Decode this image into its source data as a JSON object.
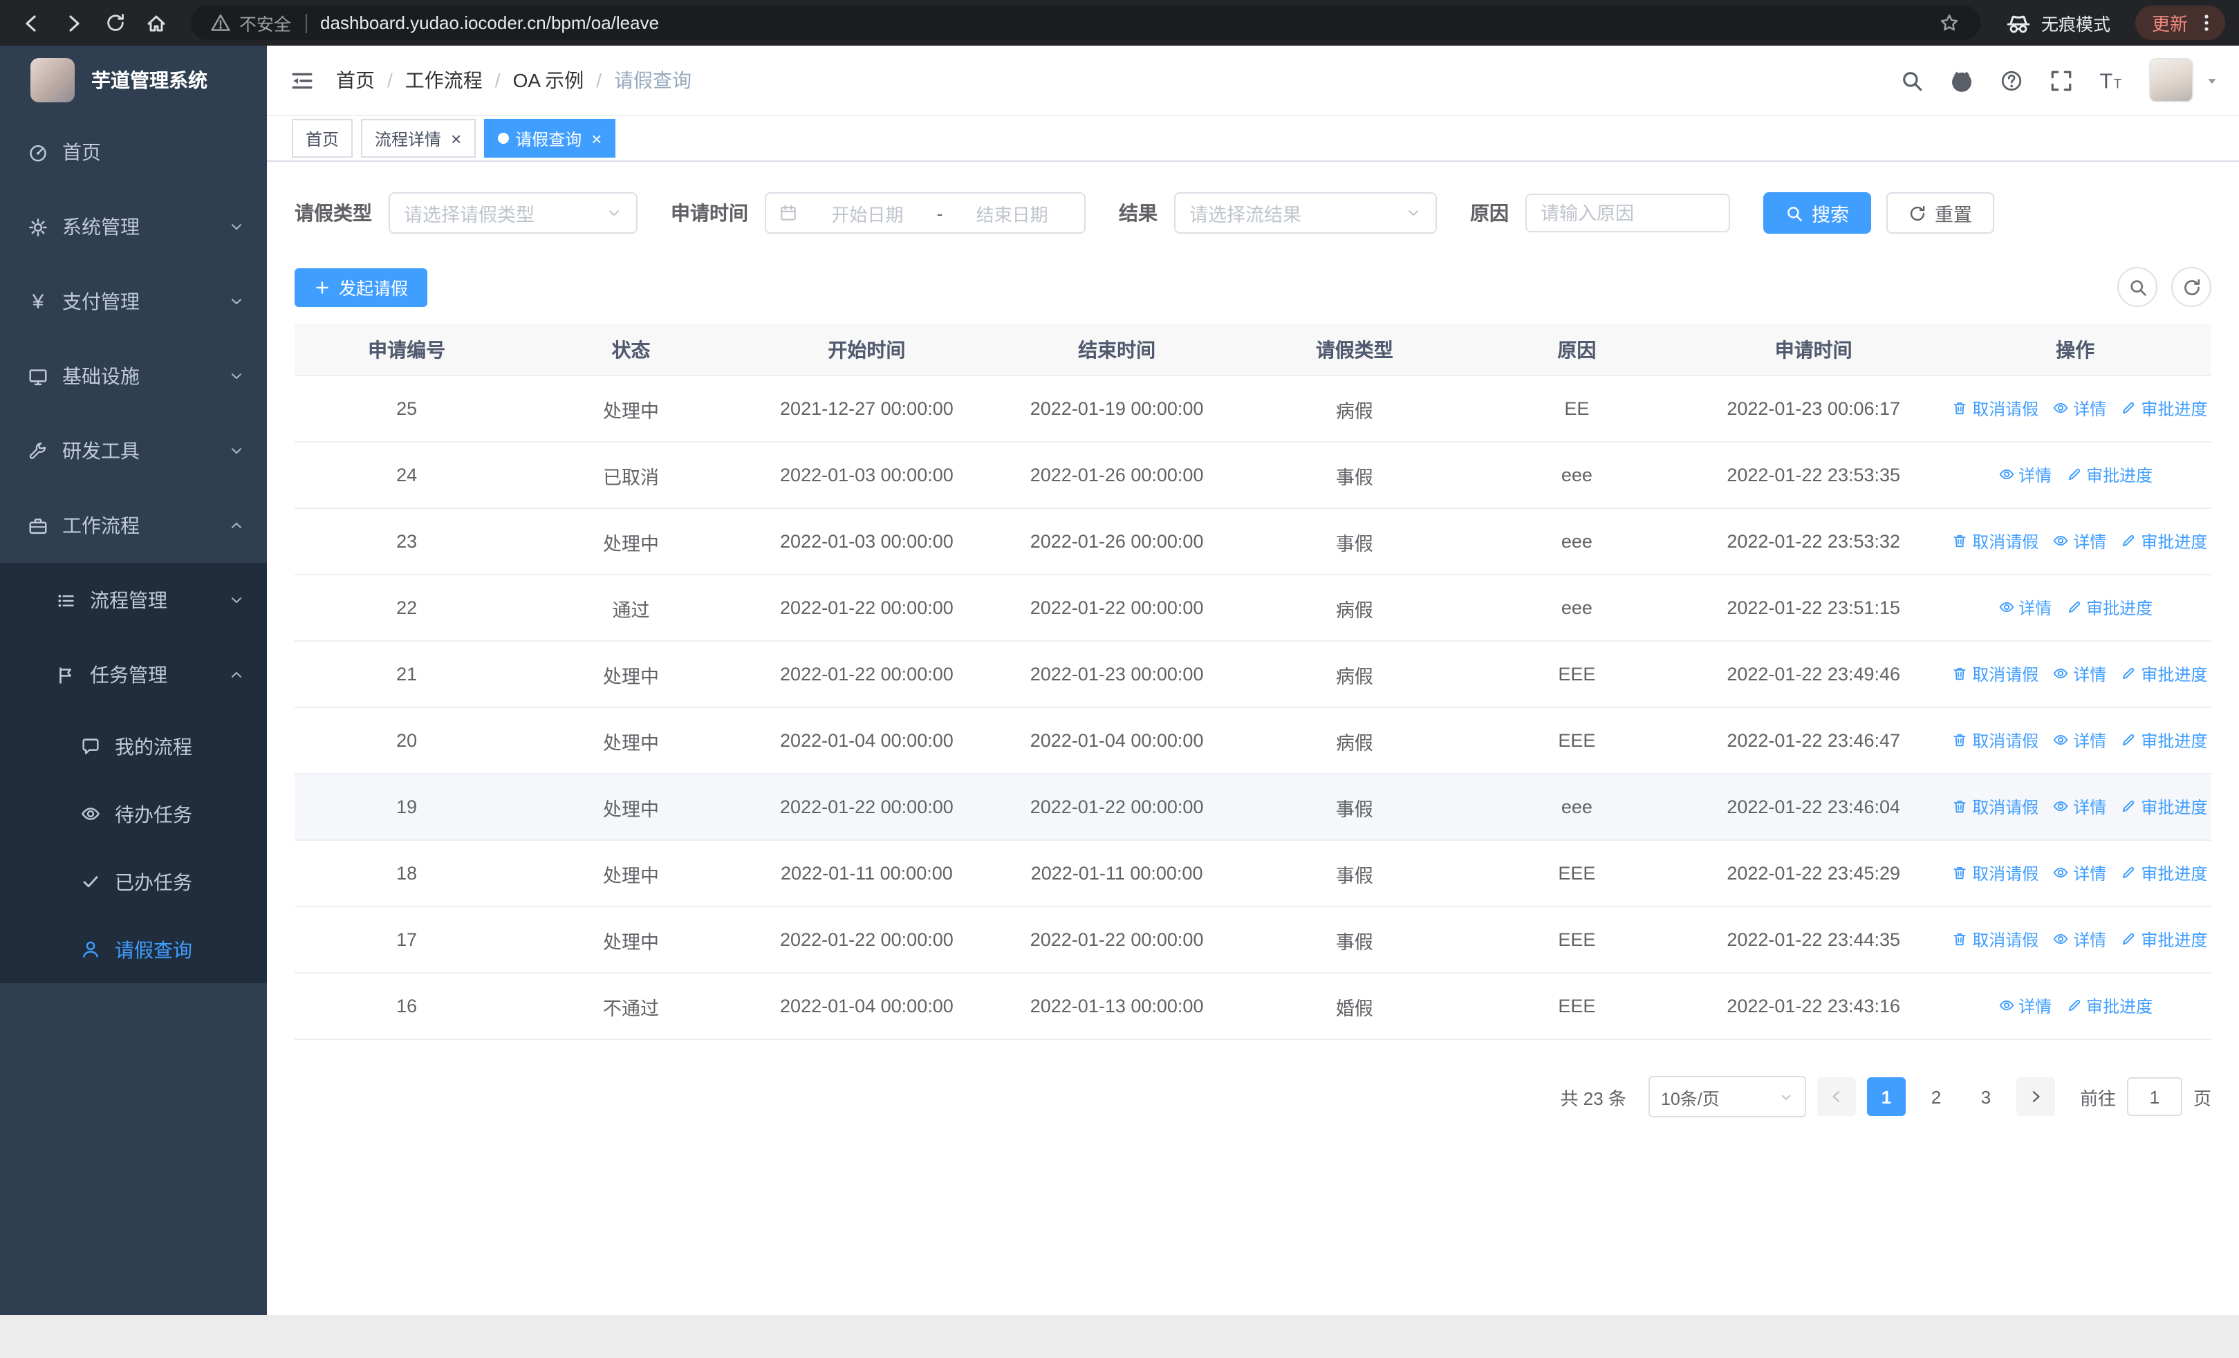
{
  "browser": {
    "url": "dashboard.yudao.iocoder.cn/bpm/oa/leave",
    "security_label": "不安全",
    "incognito_label": "无痕模式",
    "update_label": "更新"
  },
  "icons": {
    "back-icon": "left-arrow",
    "forward-icon": "right-arrow",
    "reload-icon": "circular-arrow",
    "home-icon": "house",
    "warning-icon": "triangle-exclamation",
    "star-icon": "star-outline",
    "incognito-icon": "spy-hat-glasses",
    "menu-dots-icon": "vertical-dots",
    "collapse-sidebar-icon": "hamburger-with-arrow",
    "search-icon": "magnifier",
    "github-icon": "octocat",
    "help-icon": "question-circle",
    "fullscreen-icon": "corner-arrows",
    "font-size-icon": "double-T",
    "caret-down-icon": "triangle-down",
    "calendar-icon": "calendar",
    "plus-icon": "plus",
    "refresh-icon": "circular-arrow",
    "trash-icon": "trash-can",
    "eye-icon": "eye",
    "edit-icon": "pen",
    "chevron-down-icon": "chevron-down",
    "chevron-up-icon": "chevron-up"
  },
  "colors": {
    "accent": "#409eff",
    "sidebar_bg": "#2f3e50",
    "submenu_bg": "#1f2d3d"
  },
  "sidebar": {
    "logo_title": "芋道管理系统",
    "menu": [
      {
        "label": "首页"
      },
      {
        "label": "系统管理"
      },
      {
        "label": "支付管理"
      },
      {
        "label": "基础设施"
      },
      {
        "label": "研发工具"
      },
      {
        "label": "工作流程"
      },
      {
        "label": "流程管理"
      },
      {
        "label": "任务管理"
      },
      {
        "label": "我的流程"
      },
      {
        "label": "待办任务"
      },
      {
        "label": "已办任务"
      },
      {
        "label": "请假查询"
      }
    ]
  },
  "header": {
    "breadcrumb": [
      "首页",
      "工作流程",
      "OA 示例",
      "请假查询"
    ]
  },
  "tabs": [
    {
      "label": "首页"
    },
    {
      "label": "流程详情"
    },
    {
      "label": "请假查询"
    }
  ],
  "filters": {
    "leave_type_label": "请假类型",
    "leave_type_placeholder": "请选择请假类型",
    "apply_time_label": "申请时间",
    "start_date_placeholder": "开始日期",
    "date_separator": "-",
    "end_date_placeholder": "结束日期",
    "result_label": "结果",
    "result_placeholder": "请选择流结果",
    "reason_label": "原因",
    "reason_placeholder": "请输入原因",
    "search_label": "搜索",
    "reset_label": "重置"
  },
  "toolbar": {
    "create_label": "发起请假"
  },
  "table": {
    "headers": [
      "申请编号",
      "状态",
      "开始时间",
      "结束时间",
      "请假类型",
      "原因",
      "申请时间",
      "操作"
    ],
    "actions": {
      "cancel": "取消请假",
      "detail": "详情",
      "progress": "审批进度"
    },
    "rows": [
      {
        "id": "25",
        "status": "处理中",
        "start": "2021-12-27 00:00:00",
        "end": "2022-01-19 00:00:00",
        "type": "病假",
        "reason": "EE",
        "applied": "2022-01-23 00:06:17"
      },
      {
        "id": "24",
        "status": "已取消",
        "start": "2022-01-03 00:00:00",
        "end": "2022-01-26 00:00:00",
        "type": "事假",
        "reason": "eee",
        "applied": "2022-01-22 23:53:35"
      },
      {
        "id": "23",
        "status": "处理中",
        "start": "2022-01-03 00:00:00",
        "end": "2022-01-26 00:00:00",
        "type": "事假",
        "reason": "eee",
        "applied": "2022-01-22 23:53:32"
      },
      {
        "id": "22",
        "status": "通过",
        "start": "2022-01-22 00:00:00",
        "end": "2022-01-22 00:00:00",
        "type": "病假",
        "reason": "eee",
        "applied": "2022-01-22 23:51:15"
      },
      {
        "id": "21",
        "status": "处理中",
        "start": "2022-01-22 00:00:00",
        "end": "2022-01-23 00:00:00",
        "type": "病假",
        "reason": "EEE",
        "applied": "2022-01-22 23:49:46"
      },
      {
        "id": "20",
        "status": "处理中",
        "start": "2022-01-04 00:00:00",
        "end": "2022-01-04 00:00:00",
        "type": "病假",
        "reason": "EEE",
        "applied": "2022-01-22 23:46:47"
      },
      {
        "id": "19",
        "status": "处理中",
        "start": "2022-01-22 00:00:00",
        "end": "2022-01-22 00:00:00",
        "type": "事假",
        "reason": "eee",
        "applied": "2022-01-22 23:46:04"
      },
      {
        "id": "18",
        "status": "处理中",
        "start": "2022-01-11 00:00:00",
        "end": "2022-01-11 00:00:00",
        "type": "事假",
        "reason": "EEE",
        "applied": "2022-01-22 23:45:29"
      },
      {
        "id": "17",
        "status": "处理中",
        "start": "2022-01-22 00:00:00",
        "end": "2022-01-22 00:00:00",
        "type": "事假",
        "reason": "EEE",
        "applied": "2022-01-22 23:44:35"
      },
      {
        "id": "16",
        "status": "不通过",
        "start": "2022-01-04 00:00:00",
        "end": "2022-01-13 00:00:00",
        "type": "婚假",
        "reason": "EEE",
        "applied": "2022-01-22 23:43:16"
      }
    ]
  },
  "pagination": {
    "total_label": "共 23 条",
    "page_size": "10条/页",
    "pages": [
      "1",
      "2",
      "3"
    ],
    "active_page": "1",
    "goto_label": "前往",
    "goto_value": "1",
    "unit_label": "页"
  }
}
